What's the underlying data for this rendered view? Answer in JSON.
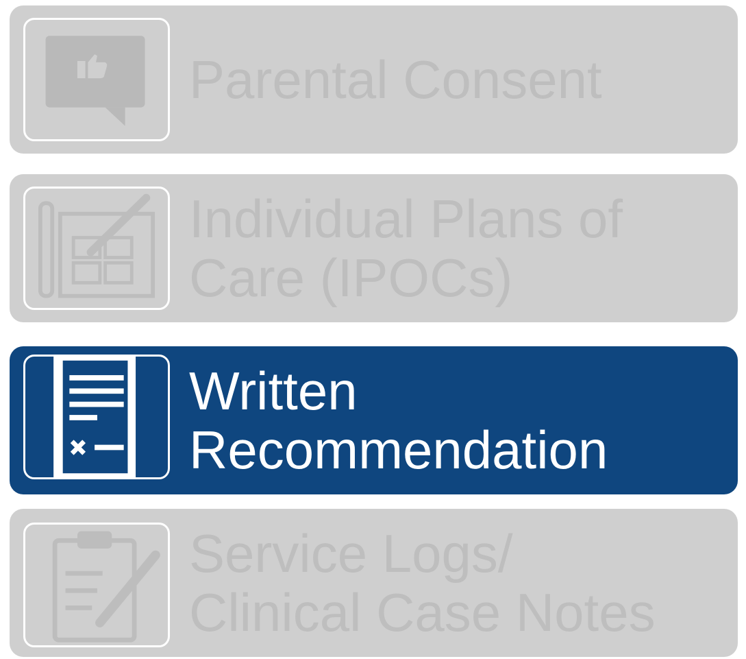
{
  "menu": {
    "items": [
      {
        "lines": [
          "Parental Consent"
        ],
        "icon": "thumbs-up-speech-bubble-icon",
        "state": "inactive"
      },
      {
        "lines": [
          "Individual Plans of",
          "Care (IPOCs)"
        ],
        "icon": "blueprint-pencil-icon",
        "state": "inactive"
      },
      {
        "lines": [
          "Written",
          "Recommendation"
        ],
        "icon": "signed-document-icon",
        "state": "active"
      },
      {
        "lines": [
          "Service Logs/",
          "Clinical Case Notes"
        ],
        "icon": "clipboard-pencil-icon",
        "state": "inactive"
      }
    ]
  },
  "colors": {
    "active_background": "#0f467f",
    "inactive_background": "#cfcfcf",
    "inactive_text": "#bebebe",
    "active_text": "#ffffff",
    "icon_frame": "#ffffff"
  }
}
